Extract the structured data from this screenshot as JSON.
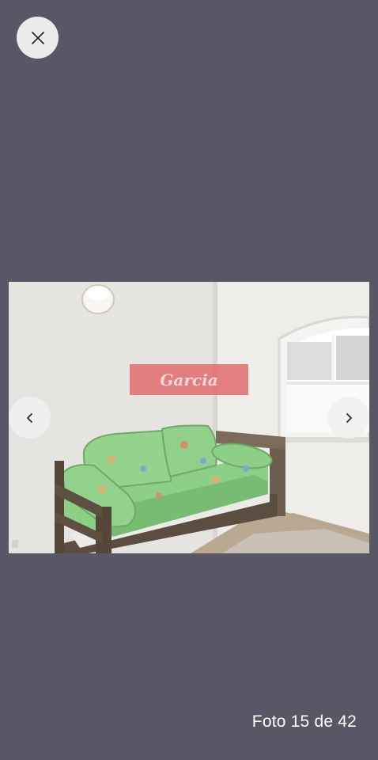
{
  "viewer": {
    "counter_text": "Foto 15 de 42",
    "background_color": "#575766"
  },
  "controls": {
    "close_icon": "close-icon",
    "prev_icon": "chevron-left-icon",
    "next_icon": "chevron-right-icon"
  },
  "photo": {
    "watermark": "Garcia",
    "watermark_color": "#e06c6c"
  }
}
